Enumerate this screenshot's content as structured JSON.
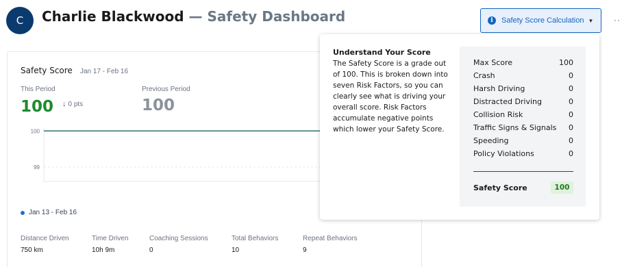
{
  "header": {
    "avatar_initial": "C",
    "name": "Charlie Blackwood",
    "separator": "—",
    "subtitle": "Safety Dashboard",
    "calc_button_label": "Safety Score Calculation",
    "more_label": "··"
  },
  "card": {
    "title": "Safety Score",
    "range": "Jan 17 - Feb 16",
    "this_period_label": "This Period",
    "this_period_value": "100",
    "delta": "0 pts",
    "previous_period_label": "Previous Period",
    "previous_period_value": "100",
    "legend": "Jan 13 - Feb 16",
    "stats": [
      {
        "label": "Distance Driven",
        "value": "750 km"
      },
      {
        "label": "Time Driven",
        "value": "10h 9m"
      },
      {
        "label": "Coaching Sessions",
        "value": "0"
      },
      {
        "label": "Total Behaviors",
        "value": "10"
      },
      {
        "label": "Repeat Behaviors",
        "value": "9"
      }
    ]
  },
  "chart_data": {
    "type": "line",
    "yticks": [
      "100",
      "99"
    ],
    "ylim": [
      98.6,
      100.1
    ],
    "series": [
      {
        "values": [
          100,
          100,
          100,
          100,
          100
        ]
      }
    ]
  },
  "popover": {
    "heading": "Understand Your Score",
    "body": "The Safety Score is a grade out of 100. This is broken down into seven Risk Factors, so you can clearly see what is driving your overall score. Risk Factors accumulate negative points which lower your Safety Score.",
    "rows": [
      {
        "label": "Max Score",
        "value": "100"
      },
      {
        "label": "Crash",
        "value": "0"
      },
      {
        "label": "Harsh Driving",
        "value": "0"
      },
      {
        "label": "Distracted Driving",
        "value": "0"
      },
      {
        "label": "Collision Risk",
        "value": "0"
      },
      {
        "label": "Traffic Signs & Signals",
        "value": "0"
      },
      {
        "label": "Speeding",
        "value": "0"
      },
      {
        "label": "Policy Violations",
        "value": "0"
      }
    ],
    "total_label": "Safety Score",
    "total_value": "100"
  },
  "colors": {
    "accent": "#1565c0",
    "score_green": "#1e8a2e",
    "previous_gray": "#8a939c",
    "line_teal": "#2f6f6f"
  }
}
